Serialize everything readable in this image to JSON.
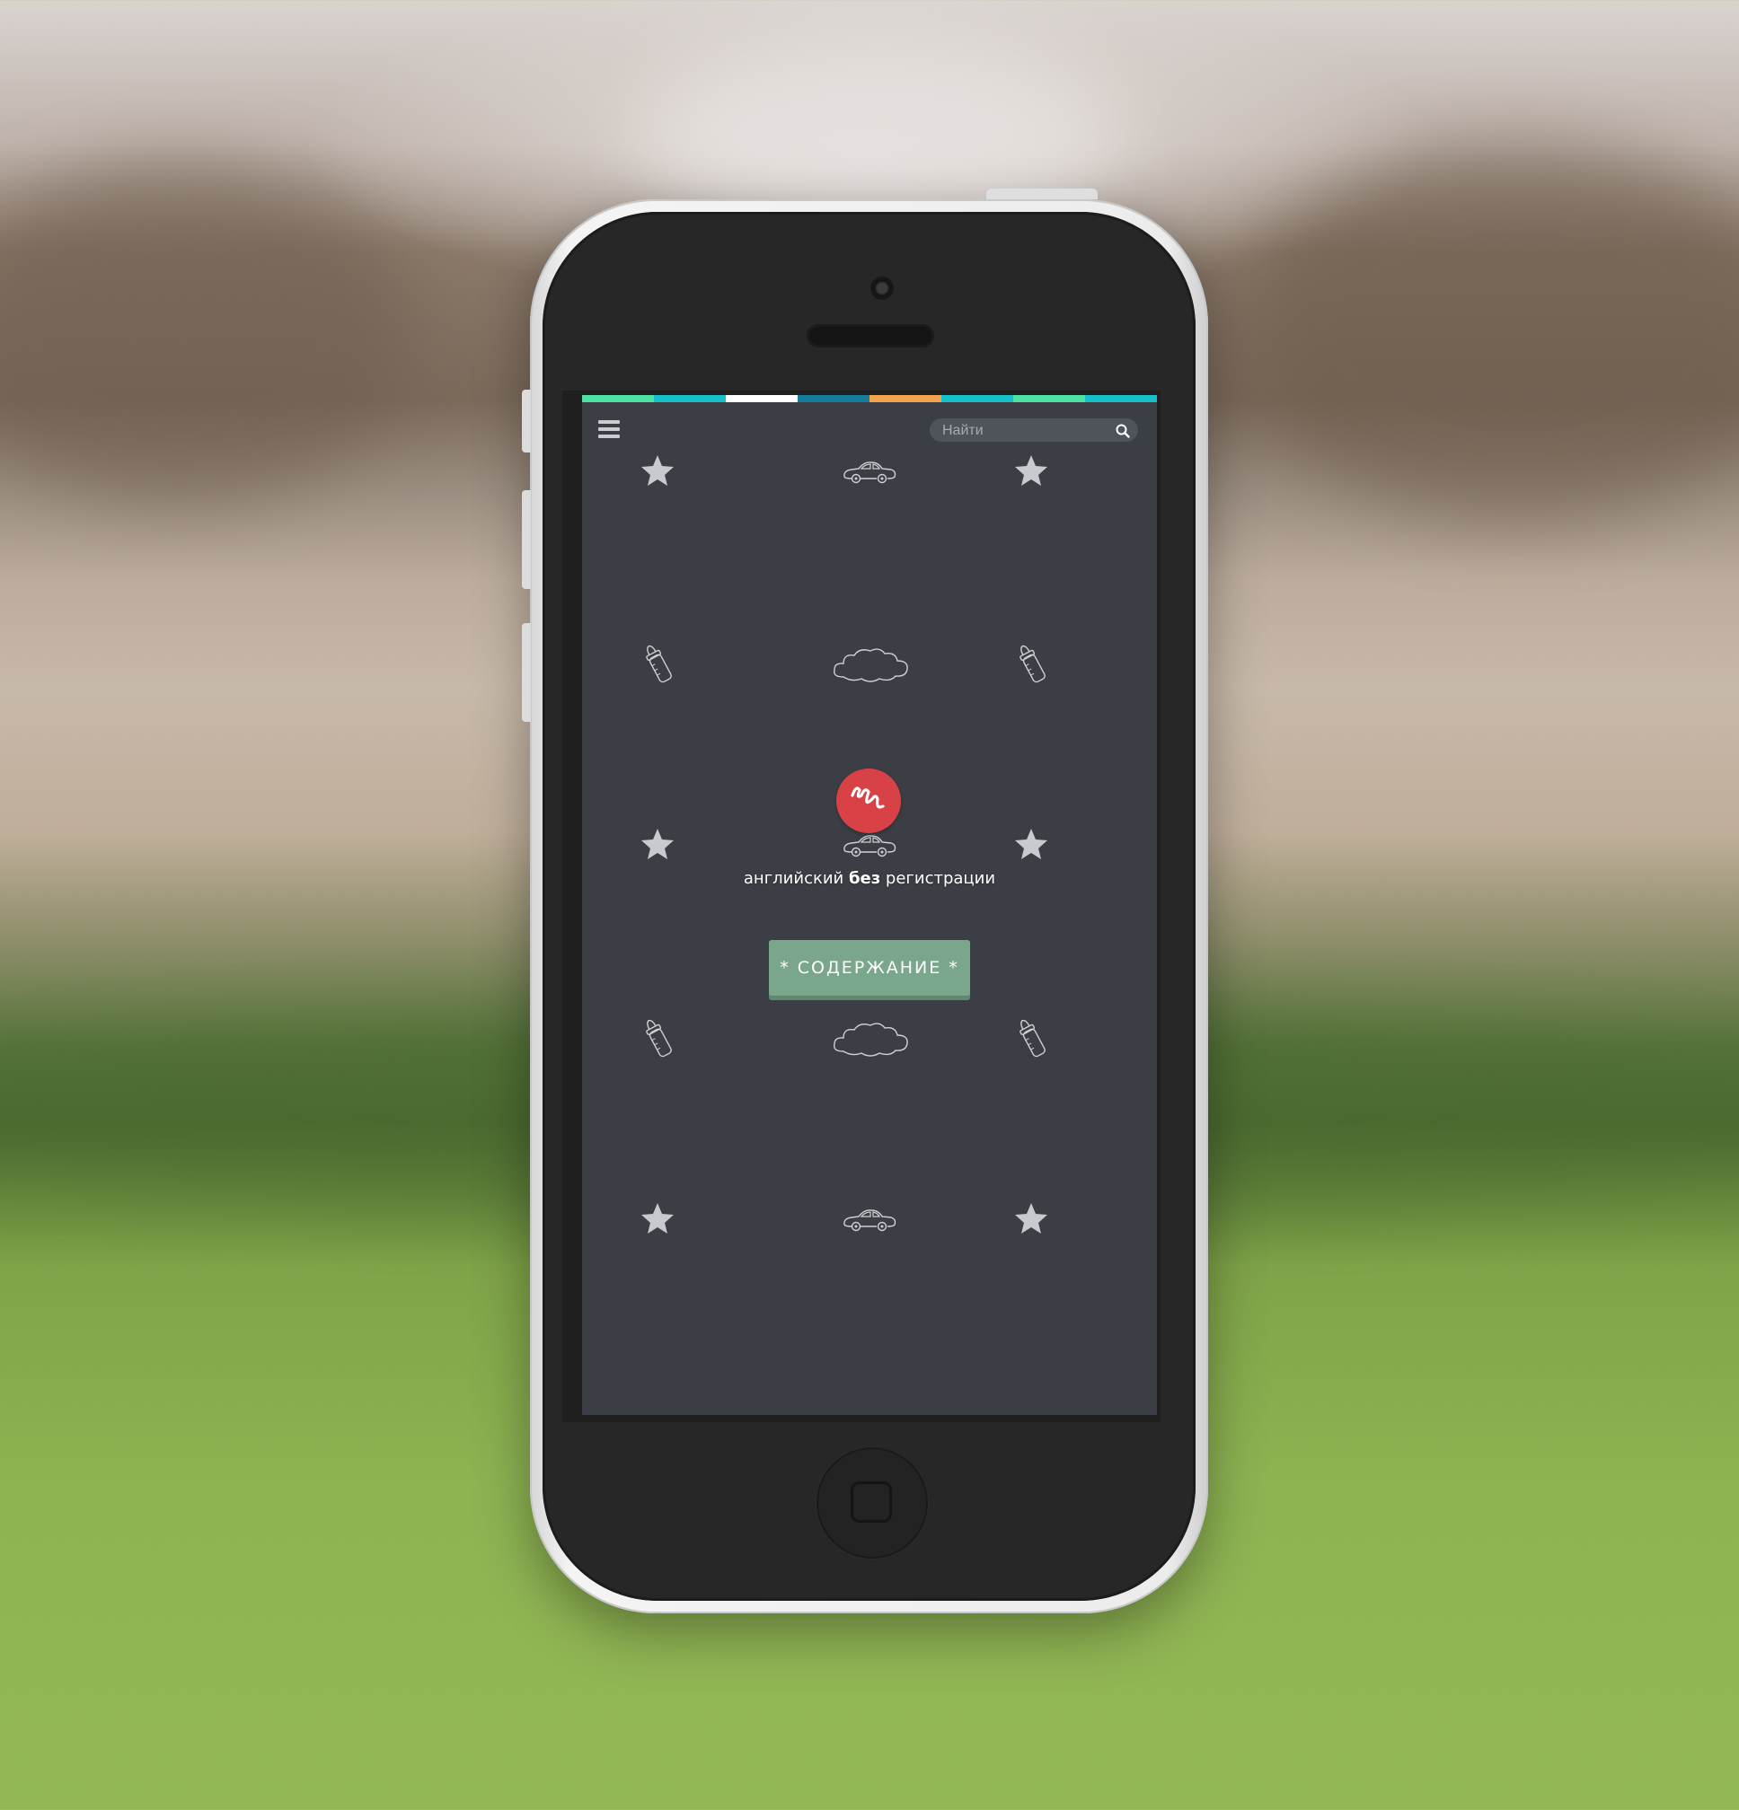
{
  "colors": {
    "screen_bg": "#3b3e44",
    "accent_red": "#d84246",
    "button_green": "#7aa68c",
    "stripes": [
      "#4fe0a4",
      "#16bfc9",
      "#ffffff",
      "#157c9c",
      "#f4a24b",
      "#16bfc9",
      "#4fe0a4",
      "#16bfc9"
    ]
  },
  "header": {
    "menu_icon": "hamburger-icon",
    "search": {
      "placeholder": "Найти",
      "value": "",
      "icon": "search-icon"
    }
  },
  "hero": {
    "logo_icon": "squiggle-logo-icon",
    "tagline_before": "английский ",
    "tagline_bold": "без",
    "tagline_after": " регистрации",
    "button_label": "* СОДЕРЖАНИЕ *"
  },
  "background_pattern": [
    "star-icon",
    "car-icon",
    "baby-bottle-icon",
    "cloud-icon"
  ]
}
